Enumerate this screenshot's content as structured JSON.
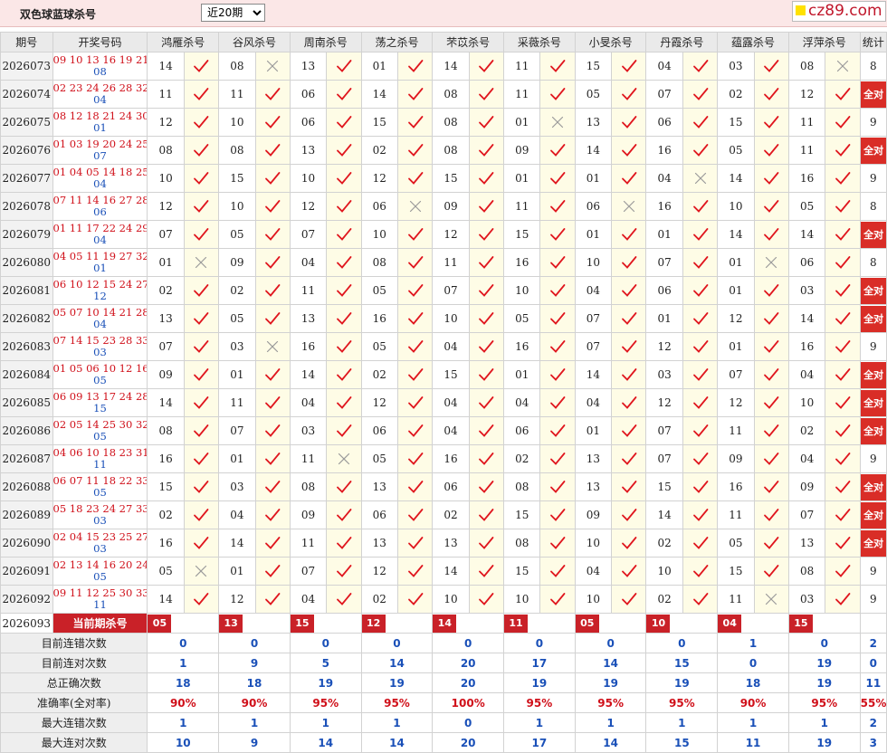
{
  "header": {
    "title": "双色球蓝球杀号",
    "period_select": {
      "selected": "近20期",
      "options": [
        "近20期"
      ]
    },
    "logo_text": "cz89.com"
  },
  "columns": {
    "period": "期号",
    "draw_numbers": "开奖号码",
    "experts": [
      "鸿雁杀号",
      "谷风杀号",
      "周南杀号",
      "荡之杀号",
      "芣苡杀号",
      "采薇杀号",
      "小旻杀号",
      "丹霞杀号",
      "蕴露杀号",
      "浮萍杀号"
    ],
    "stats": "统计"
  },
  "rows": [
    {
      "period": "2026073",
      "reds": "09 10 13 16 19 21",
      "blue": "08",
      "kills": [
        "14",
        "08",
        "13",
        "01",
        "14",
        "11",
        "15",
        "04",
        "03",
        "08"
      ],
      "ok": [
        1,
        0,
        1,
        1,
        1,
        1,
        1,
        1,
        1,
        0
      ],
      "count": "8"
    },
    {
      "period": "2026074",
      "reds": "02 23 24 26 28 32",
      "blue": "04",
      "kills": [
        "11",
        "11",
        "06",
        "14",
        "08",
        "11",
        "05",
        "07",
        "02",
        "12"
      ],
      "ok": [
        1,
        1,
        1,
        1,
        1,
        1,
        1,
        1,
        1,
        1
      ],
      "count": "全对"
    },
    {
      "period": "2026075",
      "reds": "08 12 18 21 24 30",
      "blue": "01",
      "kills": [
        "12",
        "10",
        "06",
        "15",
        "08",
        "01",
        "13",
        "06",
        "15",
        "11"
      ],
      "ok": [
        1,
        1,
        1,
        1,
        1,
        0,
        1,
        1,
        1,
        1
      ],
      "count": "9"
    },
    {
      "period": "2026076",
      "reds": "01 03 19 20 24 25",
      "blue": "07",
      "kills": [
        "08",
        "08",
        "13",
        "02",
        "08",
        "09",
        "14",
        "16",
        "05",
        "11"
      ],
      "ok": [
        1,
        1,
        1,
        1,
        1,
        1,
        1,
        1,
        1,
        1
      ],
      "count": "全对"
    },
    {
      "period": "2026077",
      "reds": "01 04 05 14 18 25",
      "blue": "04",
      "kills": [
        "10",
        "15",
        "10",
        "12",
        "15",
        "01",
        "01",
        "04",
        "14",
        "16"
      ],
      "ok": [
        1,
        1,
        1,
        1,
        1,
        1,
        1,
        0,
        1,
        1
      ],
      "count": "9"
    },
    {
      "period": "2026078",
      "reds": "07 11 14 16 27 28",
      "blue": "06",
      "kills": [
        "12",
        "10",
        "12",
        "06",
        "09",
        "11",
        "06",
        "16",
        "10",
        "05"
      ],
      "ok": [
        1,
        1,
        1,
        0,
        1,
        1,
        0,
        1,
        1,
        1
      ],
      "count": "8"
    },
    {
      "period": "2026079",
      "reds": "01 11 17 22 24 29",
      "blue": "04",
      "kills": [
        "07",
        "05",
        "07",
        "10",
        "12",
        "15",
        "01",
        "01",
        "14",
        "14"
      ],
      "ok": [
        1,
        1,
        1,
        1,
        1,
        1,
        1,
        1,
        1,
        1
      ],
      "count": "全对"
    },
    {
      "period": "2026080",
      "reds": "04 05 11 19 27 32",
      "blue": "01",
      "kills": [
        "01",
        "09",
        "04",
        "08",
        "11",
        "16",
        "10",
        "07",
        "01",
        "06"
      ],
      "ok": [
        0,
        1,
        1,
        1,
        1,
        1,
        1,
        1,
        0,
        1
      ],
      "count": "8"
    },
    {
      "period": "2026081",
      "reds": "06 10 12 15 24 27",
      "blue": "12",
      "kills": [
        "02",
        "02",
        "11",
        "05",
        "07",
        "10",
        "04",
        "06",
        "01",
        "03"
      ],
      "ok": [
        1,
        1,
        1,
        1,
        1,
        1,
        1,
        1,
        1,
        1
      ],
      "count": "全对"
    },
    {
      "period": "2026082",
      "reds": "05 07 10 14 21 28",
      "blue": "04",
      "kills": [
        "13",
        "05",
        "13",
        "16",
        "10",
        "05",
        "07",
        "01",
        "12",
        "14"
      ],
      "ok": [
        1,
        1,
        1,
        1,
        1,
        1,
        1,
        1,
        1,
        1
      ],
      "count": "全对"
    },
    {
      "period": "2026083",
      "reds": "07 14 15 23 28 33",
      "blue": "03",
      "kills": [
        "07",
        "03",
        "16",
        "05",
        "04",
        "16",
        "07",
        "12",
        "01",
        "16"
      ],
      "ok": [
        1,
        0,
        1,
        1,
        1,
        1,
        1,
        1,
        1,
        1
      ],
      "count": "9"
    },
    {
      "period": "2026084",
      "reds": "01 05 06 10 12 16",
      "blue": "05",
      "kills": [
        "09",
        "01",
        "14",
        "02",
        "15",
        "01",
        "14",
        "03",
        "07",
        "04"
      ],
      "ok": [
        1,
        1,
        1,
        1,
        1,
        1,
        1,
        1,
        1,
        1
      ],
      "count": "全对"
    },
    {
      "period": "2026085",
      "reds": "06 09 13 17 24 28",
      "blue": "15",
      "kills": [
        "14",
        "11",
        "04",
        "12",
        "04",
        "04",
        "04",
        "12",
        "12",
        "10"
      ],
      "ok": [
        1,
        1,
        1,
        1,
        1,
        1,
        1,
        1,
        1,
        1
      ],
      "count": "全对"
    },
    {
      "period": "2026086",
      "reds": "02 05 14 25 30 32",
      "blue": "05",
      "kills": [
        "08",
        "07",
        "03",
        "06",
        "04",
        "06",
        "01",
        "07",
        "11",
        "02"
      ],
      "ok": [
        1,
        1,
        1,
        1,
        1,
        1,
        1,
        1,
        1,
        1
      ],
      "count": "全对"
    },
    {
      "period": "2026087",
      "reds": "04 06 10 18 23 31",
      "blue": "11",
      "kills": [
        "16",
        "01",
        "11",
        "05",
        "16",
        "02",
        "13",
        "07",
        "09",
        "04"
      ],
      "ok": [
        1,
        1,
        0,
        1,
        1,
        1,
        1,
        1,
        1,
        1
      ],
      "count": "9"
    },
    {
      "period": "2026088",
      "reds": "06 07 11 18 22 33",
      "blue": "05",
      "kills": [
        "15",
        "03",
        "08",
        "13",
        "06",
        "08",
        "13",
        "15",
        "16",
        "09"
      ],
      "ok": [
        1,
        1,
        1,
        1,
        1,
        1,
        1,
        1,
        1,
        1
      ],
      "count": "全对"
    },
    {
      "period": "2026089",
      "reds": "05 18 23 24 27 33",
      "blue": "03",
      "kills": [
        "02",
        "04",
        "09",
        "06",
        "02",
        "15",
        "09",
        "14",
        "11",
        "07"
      ],
      "ok": [
        1,
        1,
        1,
        1,
        1,
        1,
        1,
        1,
        1,
        1
      ],
      "count": "全对"
    },
    {
      "period": "2026090",
      "reds": "02 04 15 23 25 27",
      "blue": "03",
      "kills": [
        "16",
        "14",
        "11",
        "13",
        "13",
        "08",
        "10",
        "02",
        "05",
        "13"
      ],
      "ok": [
        1,
        1,
        1,
        1,
        1,
        1,
        1,
        1,
        1,
        1
      ],
      "count": "全对"
    },
    {
      "period": "2026091",
      "reds": "02 13 14 16 20 24",
      "blue": "05",
      "kills": [
        "05",
        "01",
        "07",
        "12",
        "14",
        "15",
        "04",
        "10",
        "15",
        "08"
      ],
      "ok": [
        0,
        1,
        1,
        1,
        1,
        1,
        1,
        1,
        1,
        1
      ],
      "count": "9"
    },
    {
      "period": "2026092",
      "reds": "09 11 12 25 30 33",
      "blue": "11",
      "kills": [
        "14",
        "12",
        "04",
        "02",
        "10",
        "10",
        "10",
        "02",
        "11",
        "03"
      ],
      "ok": [
        1,
        1,
        1,
        1,
        1,
        1,
        1,
        1,
        0,
        1
      ],
      "count": "9"
    }
  ],
  "current": {
    "period": "2026093",
    "label": "当前期杀号",
    "kills": [
      "05",
      "13",
      "15",
      "12",
      "14",
      "11",
      "05",
      "10",
      "04",
      "15"
    ]
  },
  "stats": [
    {
      "label": "目前连错次数",
      "values": [
        "0",
        "0",
        "0",
        "0",
        "0",
        "0",
        "0",
        "0",
        "1",
        "0"
      ],
      "total": "2",
      "tone": "blue"
    },
    {
      "label": "目前连对次数",
      "values": [
        "1",
        "9",
        "5",
        "14",
        "20",
        "17",
        "14",
        "15",
        "0",
        "19"
      ],
      "total": "0",
      "tone": "blue"
    },
    {
      "label": "总正确次数",
      "values": [
        "18",
        "18",
        "19",
        "19",
        "20",
        "19",
        "19",
        "19",
        "18",
        "19"
      ],
      "total": "11",
      "tone": "blue"
    },
    {
      "label": "准确率(全对率)",
      "values": [
        "90%",
        "90%",
        "95%",
        "95%",
        "100%",
        "95%",
        "95%",
        "95%",
        "90%",
        "95%"
      ],
      "total": "55%",
      "tone": "red"
    },
    {
      "label": "最大连错次数",
      "values": [
        "1",
        "1",
        "1",
        "1",
        "0",
        "1",
        "1",
        "1",
        "1",
        "1"
      ],
      "total": "2",
      "tone": "blue"
    },
    {
      "label": "最大连对次数",
      "values": [
        "10",
        "9",
        "14",
        "14",
        "20",
        "17",
        "14",
        "15",
        "11",
        "19"
      ],
      "total": "3",
      "tone": "blue"
    }
  ],
  "marks": {
    "correct": "check-icon",
    "wrong": "cross-icon"
  },
  "colors": {
    "header_bg": "#fbe7e7",
    "accent_red": "#c92128",
    "number_red": "#d0101a",
    "number_blue": "#1a50b8",
    "mark_bg": "#fefce6",
    "check": "#e0161e",
    "cross": "#9a9a9a"
  }
}
